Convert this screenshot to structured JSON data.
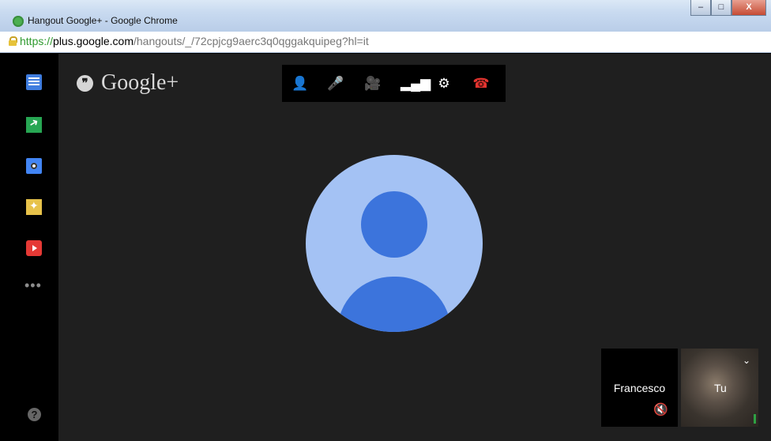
{
  "window": {
    "title": "Hangout Google+ - Google Chrome",
    "controls": {
      "minimize": "–",
      "maximize": "□",
      "close": "X"
    }
  },
  "address": {
    "scheme": "https://",
    "host": "plus.google.com",
    "path": "/hangouts/_/72cpjcg9aerc3q0qggakquipeg?hl=it"
  },
  "brand": {
    "text": "Google+",
    "quote_glyph": "❞"
  },
  "rail": {
    "items": [
      "chat-icon",
      "screenshare-icon",
      "camera-icon",
      "effects-icon",
      "youtube-icon"
    ],
    "more": "•••",
    "help": "?"
  },
  "toolbar": {
    "invite": "👤",
    "mic": "🎤",
    "camera": "🎥",
    "bandwidth": "▂▄▆",
    "settings": "⚙",
    "hangup": "☎",
    "hangup_color": "#e3342f"
  },
  "participants": {
    "francesco": {
      "name": "Francesco",
      "muted_icon": "🔇"
    },
    "self": {
      "name": "Tu",
      "menu_icon": "⌄"
    }
  },
  "colors": {
    "accent": "#3c74dc",
    "avatar_bg": "#a4c2f4",
    "stage_bg": "#1f1f1f"
  }
}
